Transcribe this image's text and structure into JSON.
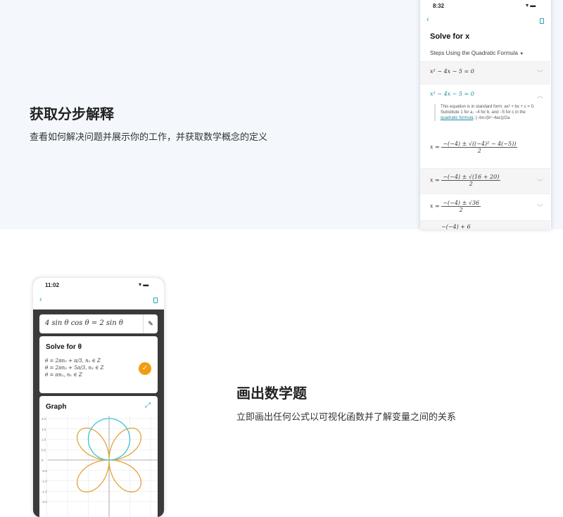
{
  "section1": {
    "title": "获取分步解释",
    "description": "查看如何解决问题并展示你的工作，并获取数学概念的定义"
  },
  "section2": {
    "title": "画出数学题",
    "description": "立即画出任何公式以可视化函数并了解变量之间的关系"
  },
  "phone1": {
    "time": "8:32",
    "heading": "Solve for x",
    "method": "Steps Using the Quadratic Formula",
    "method_caret": "▼",
    "step1": "x² − 4x − 5 = 0",
    "step2": "x² − 4x − 5 = 0",
    "explanation_pre": "This equation is in standard form: ax² + bx + c = 0. Substitute 1 for a, −4 for b, and −5 for c in the ",
    "explanation_link": "quadratic formula",
    "explanation_post": ", (−b±√(b²−4ac))/2a.",
    "eq1_num": "−(−4) ± √((−4)² − 4(−5))",
    "eq1_den": "2",
    "eq2_num": "−(−4) ± √(16 + 20)",
    "eq2_den": "2",
    "eq3_num": "−(−4) ± √36",
    "eq3_den": "2",
    "eq4_num": "−(−4) + 6",
    "x_eq": "x ="
  },
  "phone2": {
    "time": "11:02",
    "input": "4 sin θ cos θ = 2 sin θ",
    "solve_heading": "Solve for θ",
    "solutions": [
      "θ = 2πn₂ + π/3, n₂ ∈ Z",
      "θ = 2πn₃ + 5π/3, n₃ ∈ Z",
      "θ = πn₁, n₁ ∈ Z"
    ],
    "graph_heading": "Graph",
    "y_ticks": [
      "2.0",
      "1.5",
      "1.0",
      "0.5",
      "0",
      "-0.5",
      "-1.0",
      "-1.5",
      "-2.0"
    ],
    "colors": {
      "circle": "#3cc4d6",
      "rose": "#e2a53a",
      "check": "#f39c12",
      "accent": "#2aa0b8"
    }
  }
}
